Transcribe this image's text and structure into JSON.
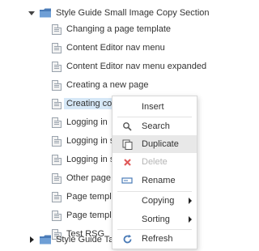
{
  "tree": {
    "root": {
      "label": "Style Guide Small Image Copy Section"
    },
    "items": [
      {
        "label": "Changing a page template"
      },
      {
        "label": "Content Editor nav menu"
      },
      {
        "label": "Content Editor nav menu expanded"
      },
      {
        "label": "Creating a new page"
      },
      {
        "label": "Creating com"
      },
      {
        "label": "Logging in"
      },
      {
        "label": "Logging in st"
      },
      {
        "label": "Logging in st"
      },
      {
        "label": "Other page t"
      },
      {
        "label": "Page templa"
      },
      {
        "label": "Page templa"
      },
      {
        "label": "Test RSG"
      }
    ],
    "sibling": {
      "label": "Style Guide Tab"
    }
  },
  "context_menu": {
    "items": [
      {
        "label": "Insert",
        "icon": "none"
      },
      {
        "label": "Search",
        "icon": "search-icon"
      },
      {
        "label": "Duplicate",
        "icon": "duplicate-icon"
      },
      {
        "label": "Delete",
        "icon": "delete-icon"
      },
      {
        "label": "Rename",
        "icon": "rename-icon"
      },
      {
        "label": "Copying",
        "icon": "none"
      },
      {
        "label": "Sorting",
        "icon": "none"
      },
      {
        "label": "Refresh",
        "icon": "refresh-icon"
      }
    ]
  },
  "colors": {
    "selection": "#d6e8f7",
    "hover": "#e8e8e8",
    "folder": "#4a7bb7",
    "delete_icon": "#e05a5a"
  }
}
